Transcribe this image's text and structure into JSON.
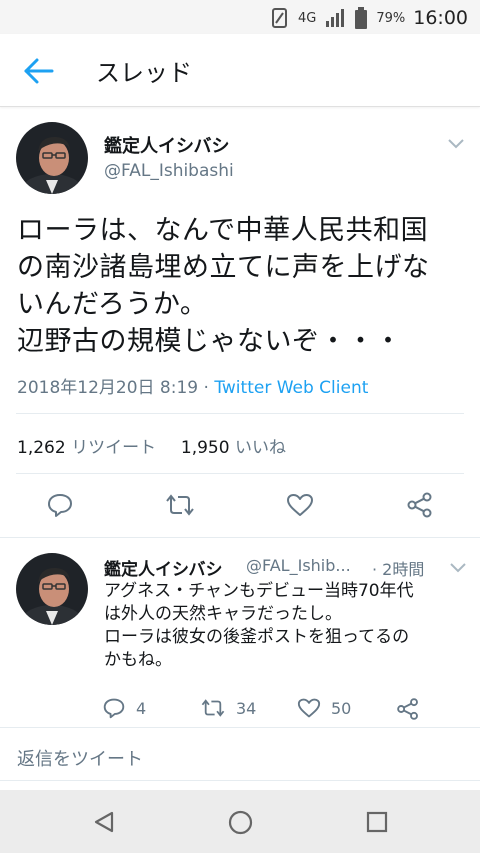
{
  "status_bar": {
    "network": "4G",
    "battery": "79%",
    "time": "16:00",
    "icons": [
      "vibrate-icon",
      "signal-icon",
      "battery-icon"
    ]
  },
  "header": {
    "title": "スレッド",
    "back_icon": "arrow-left-icon"
  },
  "tweet": {
    "name": "鑑定人イシバシ",
    "handle": "@FAL_Ishibashi",
    "text_lines": [
      "ローラは、なんで中華人民共和国",
      "の南沙諸島埋め立てに声を上げな",
      "いんだろうか。",
      "辺野古の規模じゃないぞ・・・"
    ],
    "date": "2018年12月20日 8:19",
    "separator": "·",
    "client": "Twitter Web Client",
    "retweets": "1,262",
    "retweets_label": "リツイート",
    "likes": "1,950",
    "likes_label": "いいね"
  },
  "reply": {
    "name": "鑑定人イシバシ",
    "handle": "@FAL_Ishib...",
    "time": "· 2時間",
    "text_lines": [
      "アグネス・チャンもデビュー当時70年代",
      "は外人の天然キャラだったし。",
      "ローラは彼女の後釜ポストを狙ってるの",
      "かもね。"
    ],
    "replies": "4",
    "retweets": "34",
    "likes": "50"
  },
  "compose": {
    "placeholder": "返信をツイート"
  },
  "colors": {
    "accent": "#1da1f2",
    "secondary": "#657786",
    "text": "#14171a",
    "divider": "#e6ecf0"
  }
}
